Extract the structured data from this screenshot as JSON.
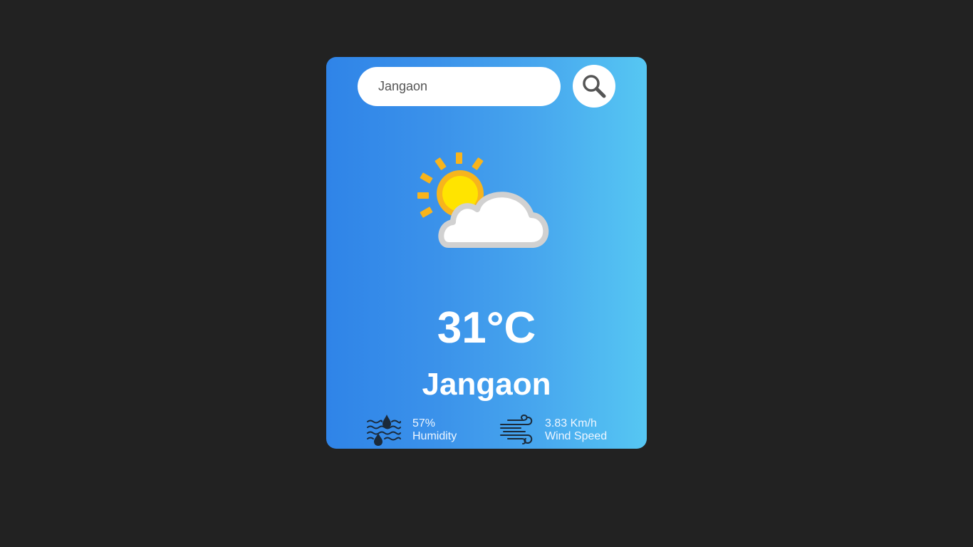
{
  "search": {
    "value": "Jangaon",
    "icon": "search-icon"
  },
  "weather": {
    "icon": "partly-cloudy-icon",
    "temperature": "31°C",
    "city": "Jangaon"
  },
  "details": {
    "humidity": {
      "icon": "humidity-icon",
      "value": "57%",
      "label": "Humidity"
    },
    "wind": {
      "icon": "wind-icon",
      "value": "3.83 Km/h",
      "label": "Wind Speed"
    }
  },
  "colors": {
    "background": "#222222",
    "card_gradient_start": "#2f84e8",
    "card_gradient_end": "#56c7f3",
    "sun": "#ffc107",
    "cloud": "#ffffff"
  }
}
